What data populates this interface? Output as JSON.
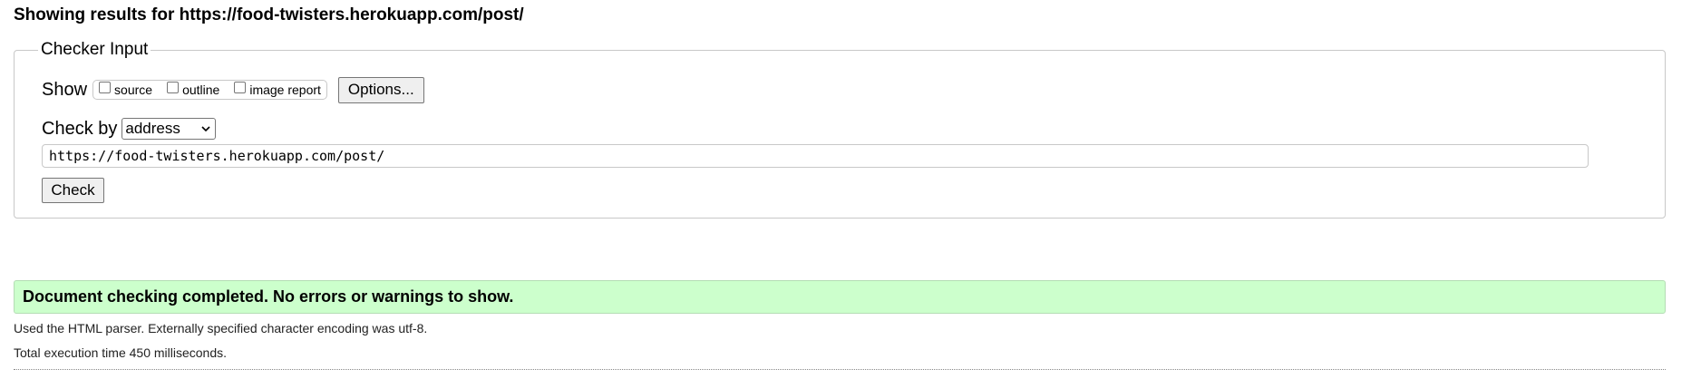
{
  "heading": "Showing results for https://food-twisters.herokuapp.com/post/",
  "checker": {
    "legend": "Checker Input",
    "show_label": "Show",
    "options": [
      {
        "label": "source",
        "checked": false
      },
      {
        "label": "outline",
        "checked": false
      },
      {
        "label": "image report",
        "checked": false
      }
    ],
    "options_button": "Options...",
    "check_by_label": "Check by",
    "check_by_value": "address",
    "url_value": "https://food-twisters.herokuapp.com/post/",
    "check_button": "Check"
  },
  "result": {
    "message": "Document checking completed. No errors or warnings to show.",
    "success_color": "#ccffcc"
  },
  "info": {
    "parser": "Used the HTML parser. Externally specified character encoding was utf-8.",
    "execution_time": "Total execution time 450 milliseconds."
  }
}
